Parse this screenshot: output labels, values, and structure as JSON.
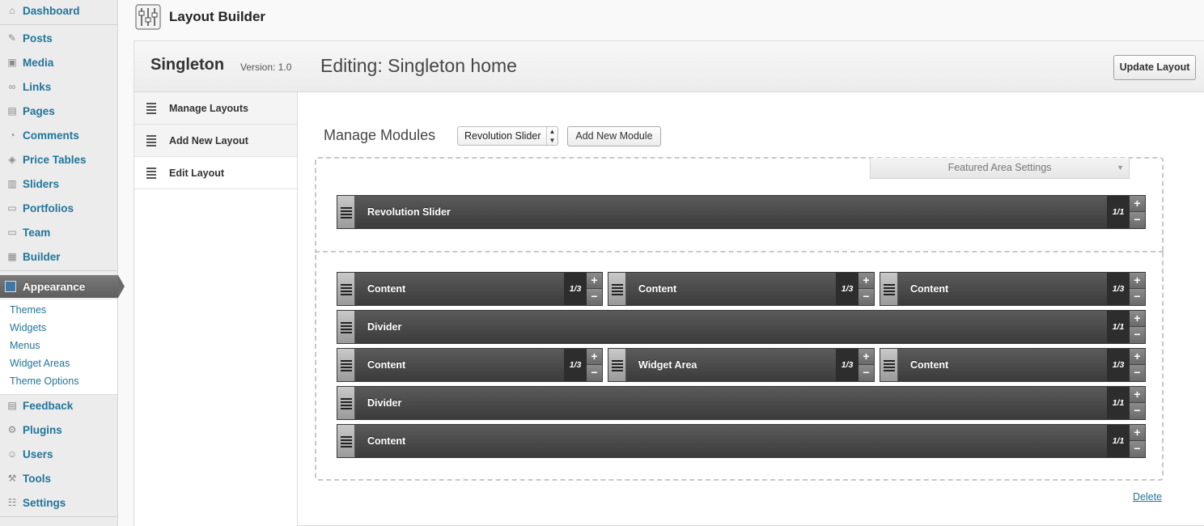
{
  "sidebar": {
    "items": [
      {
        "label": "Dashboard",
        "icon": "dashboard-icon"
      },
      {
        "label": "Posts",
        "icon": "pin-icon"
      },
      {
        "label": "Media",
        "icon": "media-icon"
      },
      {
        "label": "Links",
        "icon": "link-icon"
      },
      {
        "label": "Pages",
        "icon": "pages-icon"
      },
      {
        "label": "Comments",
        "icon": "comment-icon"
      },
      {
        "label": "Price Tables",
        "icon": "tag-icon"
      },
      {
        "label": "Sliders",
        "icon": "slider-icon"
      },
      {
        "label": "Portfolios",
        "icon": "folder-icon"
      },
      {
        "label": "Team",
        "icon": "folder-icon"
      },
      {
        "label": "Builder",
        "icon": "builder-icon"
      },
      {
        "label": "Appearance",
        "icon": "appearance-icon"
      },
      {
        "label": "Feedback",
        "icon": "feedback-icon"
      },
      {
        "label": "Plugins",
        "icon": "plugin-icon"
      },
      {
        "label": "Users",
        "icon": "users-icon"
      },
      {
        "label": "Tools",
        "icon": "tools-icon"
      },
      {
        "label": "Settings",
        "icon": "settings-icon"
      }
    ],
    "submenu": [
      "Themes",
      "Widgets",
      "Menus",
      "Widget Areas",
      "Theme Options"
    ]
  },
  "page": {
    "title": "Layout Builder"
  },
  "builder": {
    "theme_name": "Singleton",
    "version": "Version: 1.0",
    "editing": "Editing: Singleton home",
    "update_label": "Update Layout",
    "nav": [
      "Manage Layouts",
      "Add New Layout",
      "Edit Layout"
    ],
    "manage_modules_label": "Manage Modules",
    "module_select_value": "Revolution Slider",
    "add_module_label": "Add New Module",
    "featured_settings_label": "Featured Area Settings",
    "delete_label": "Delete"
  },
  "modules": {
    "featured": [
      {
        "name": "Revolution Slider",
        "size": "1/1"
      }
    ],
    "main": [
      {
        "name": "Content",
        "size": "1/3"
      },
      {
        "name": "Content",
        "size": "1/3"
      },
      {
        "name": "Content",
        "size": "1/3"
      },
      {
        "name": "Divider",
        "size": "1/1"
      },
      {
        "name": "Content",
        "size": "1/3"
      },
      {
        "name": "Widget Area",
        "size": "1/3"
      },
      {
        "name": "Content",
        "size": "1/3"
      },
      {
        "name": "Divider",
        "size": "1/1"
      },
      {
        "name": "Content",
        "size": "1/1"
      }
    ]
  },
  "symbols": {
    "plus": "+",
    "minus": "−",
    "caret_updown": "▲▼",
    "caret_down": "▼"
  }
}
